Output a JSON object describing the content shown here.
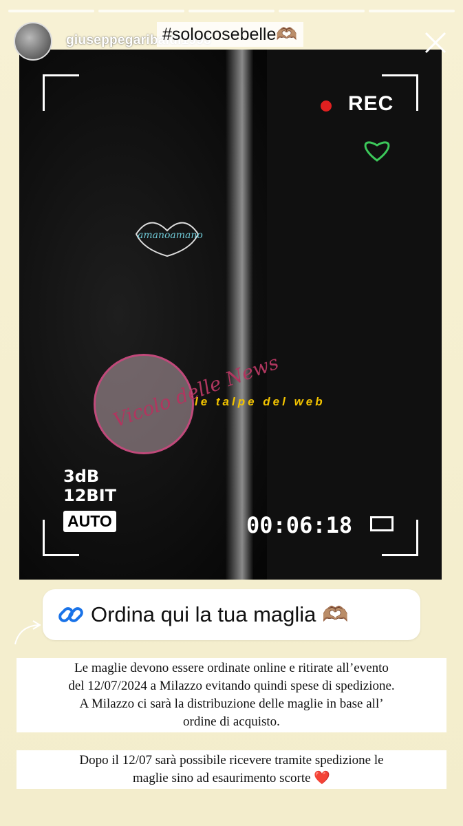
{
  "story": {
    "username": "giuseppegaribaldi1993",
    "hashtag": "#solocosebelle🫶🏽",
    "close_icon": "close-icon"
  },
  "camera_overlay": {
    "rec_label": "REC",
    "audio_level": "3dB",
    "bit_depth": "12BIT",
    "mode": "AUTO",
    "timer": "00:06:18"
  },
  "watermarks": {
    "vicolo": "Vicolo delle News",
    "talpe": "le talpe del web"
  },
  "link_sticker": {
    "label": "Ordina qui la tua maglia 🫶🏽",
    "icon": "link-icon"
  },
  "text_blocks": [
    {
      "lines": [
        "Le maglie devono essere ordinate online e ritirate all’evento",
        "del 12/07/2024 a Milazzo evitando quindi spese di spedizione.",
        "A Milazzo ci sarà la distribuzione delle maglie in base all’",
        "ordine di acquisto."
      ]
    },
    {
      "lines": [
        "Dopo il 12/07 sarà possibile ricevere tramite spedizione le",
        "maglie sino ad esaurimento scorte ❤️"
      ]
    }
  ],
  "colors": {
    "background": "#f4efcf",
    "rec_dot": "#e02020",
    "watermark_yellow": "#f2c300",
    "vicolo_pink": "#c0497a"
  }
}
